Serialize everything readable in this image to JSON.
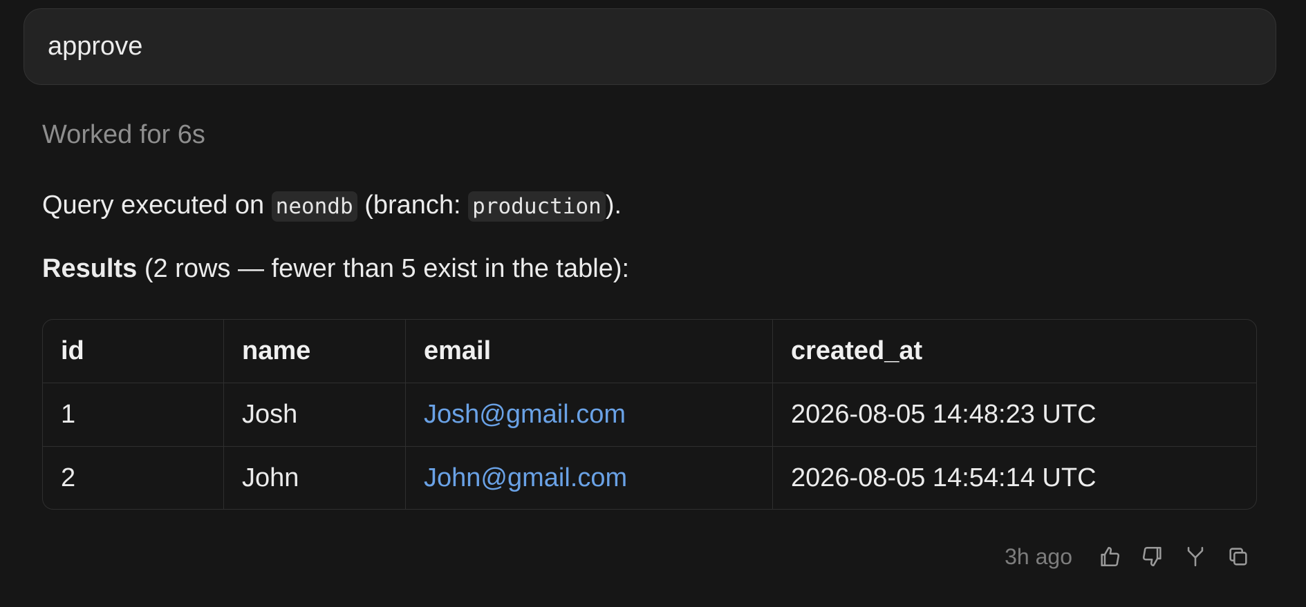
{
  "user_message": {
    "text": "approve"
  },
  "assistant": {
    "worked_for": "Worked for 6s",
    "query_line": {
      "prefix": "Query executed on ",
      "db": "neondb",
      "middle": " (branch: ",
      "branch": "production",
      "suffix": ")."
    },
    "results_line": {
      "bold": "Results",
      "rest": " (2 rows — fewer than 5 exist in the table):"
    },
    "table": {
      "headers": [
        "id",
        "name",
        "email",
        "created_at"
      ],
      "rows": [
        [
          "1",
          "Josh",
          "Josh@gmail.com",
          "2026-08-05 14:48:23 UTC"
        ],
        [
          "2",
          "John",
          "John@gmail.com",
          "2026-08-05 14:54:14 UTC"
        ]
      ]
    },
    "footer": {
      "time": "3h ago",
      "icons": [
        "thumbs-up-icon",
        "thumbs-down-icon",
        "branch-icon",
        "copy-icon"
      ]
    }
  },
  "colors": {
    "background": "#161616",
    "bubble": "#232323",
    "link": "#6aa2e6",
    "muted": "#8e8e8e"
  }
}
